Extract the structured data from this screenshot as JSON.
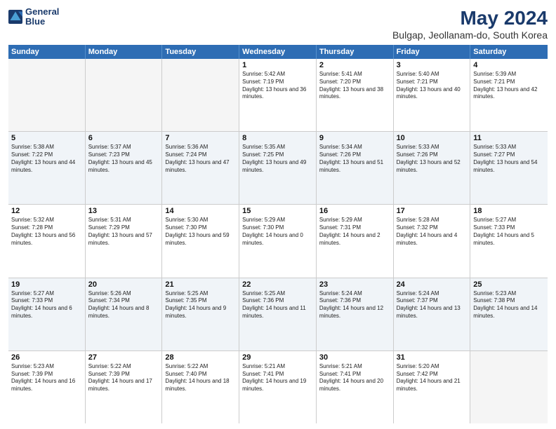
{
  "header": {
    "logo_line1": "General",
    "logo_line2": "Blue",
    "title": "May 2024",
    "subtitle": "Bulgap, Jeollanam-do, South Korea"
  },
  "days_of_week": [
    "Sunday",
    "Monday",
    "Tuesday",
    "Wednesday",
    "Thursday",
    "Friday",
    "Saturday"
  ],
  "weeks": [
    [
      {
        "day": "",
        "empty": true
      },
      {
        "day": "",
        "empty": true
      },
      {
        "day": "",
        "empty": true
      },
      {
        "day": "1",
        "sunrise": "5:42 AM",
        "sunset": "7:19 PM",
        "daylight": "13 hours and 36 minutes."
      },
      {
        "day": "2",
        "sunrise": "5:41 AM",
        "sunset": "7:20 PM",
        "daylight": "13 hours and 38 minutes."
      },
      {
        "day": "3",
        "sunrise": "5:40 AM",
        "sunset": "7:21 PM",
        "daylight": "13 hours and 40 minutes."
      },
      {
        "day": "4",
        "sunrise": "5:39 AM",
        "sunset": "7:21 PM",
        "daylight": "13 hours and 42 minutes."
      }
    ],
    [
      {
        "day": "5",
        "sunrise": "5:38 AM",
        "sunset": "7:22 PM",
        "daylight": "13 hours and 44 minutes."
      },
      {
        "day": "6",
        "sunrise": "5:37 AM",
        "sunset": "7:23 PM",
        "daylight": "13 hours and 45 minutes."
      },
      {
        "day": "7",
        "sunrise": "5:36 AM",
        "sunset": "7:24 PM",
        "daylight": "13 hours and 47 minutes."
      },
      {
        "day": "8",
        "sunrise": "5:35 AM",
        "sunset": "7:25 PM",
        "daylight": "13 hours and 49 minutes."
      },
      {
        "day": "9",
        "sunrise": "5:34 AM",
        "sunset": "7:26 PM",
        "daylight": "13 hours and 51 minutes."
      },
      {
        "day": "10",
        "sunrise": "5:33 AM",
        "sunset": "7:26 PM",
        "daylight": "13 hours and 52 minutes."
      },
      {
        "day": "11",
        "sunrise": "5:33 AM",
        "sunset": "7:27 PM",
        "daylight": "13 hours and 54 minutes."
      }
    ],
    [
      {
        "day": "12",
        "sunrise": "5:32 AM",
        "sunset": "7:28 PM",
        "daylight": "13 hours and 56 minutes."
      },
      {
        "day": "13",
        "sunrise": "5:31 AM",
        "sunset": "7:29 PM",
        "daylight": "13 hours and 57 minutes."
      },
      {
        "day": "14",
        "sunrise": "5:30 AM",
        "sunset": "7:30 PM",
        "daylight": "13 hours and 59 minutes."
      },
      {
        "day": "15",
        "sunrise": "5:29 AM",
        "sunset": "7:30 PM",
        "daylight": "14 hours and 0 minutes."
      },
      {
        "day": "16",
        "sunrise": "5:29 AM",
        "sunset": "7:31 PM",
        "daylight": "14 hours and 2 minutes."
      },
      {
        "day": "17",
        "sunrise": "5:28 AM",
        "sunset": "7:32 PM",
        "daylight": "14 hours and 4 minutes."
      },
      {
        "day": "18",
        "sunrise": "5:27 AM",
        "sunset": "7:33 PM",
        "daylight": "14 hours and 5 minutes."
      }
    ],
    [
      {
        "day": "19",
        "sunrise": "5:27 AM",
        "sunset": "7:33 PM",
        "daylight": "14 hours and 6 minutes."
      },
      {
        "day": "20",
        "sunrise": "5:26 AM",
        "sunset": "7:34 PM",
        "daylight": "14 hours and 8 minutes."
      },
      {
        "day": "21",
        "sunrise": "5:25 AM",
        "sunset": "7:35 PM",
        "daylight": "14 hours and 9 minutes."
      },
      {
        "day": "22",
        "sunrise": "5:25 AM",
        "sunset": "7:36 PM",
        "daylight": "14 hours and 11 minutes."
      },
      {
        "day": "23",
        "sunrise": "5:24 AM",
        "sunset": "7:36 PM",
        "daylight": "14 hours and 12 minutes."
      },
      {
        "day": "24",
        "sunrise": "5:24 AM",
        "sunset": "7:37 PM",
        "daylight": "14 hours and 13 minutes."
      },
      {
        "day": "25",
        "sunrise": "5:23 AM",
        "sunset": "7:38 PM",
        "daylight": "14 hours and 14 minutes."
      }
    ],
    [
      {
        "day": "26",
        "sunrise": "5:23 AM",
        "sunset": "7:39 PM",
        "daylight": "14 hours and 16 minutes."
      },
      {
        "day": "27",
        "sunrise": "5:22 AM",
        "sunset": "7:39 PM",
        "daylight": "14 hours and 17 minutes."
      },
      {
        "day": "28",
        "sunrise": "5:22 AM",
        "sunset": "7:40 PM",
        "daylight": "14 hours and 18 minutes."
      },
      {
        "day": "29",
        "sunrise": "5:21 AM",
        "sunset": "7:41 PM",
        "daylight": "14 hours and 19 minutes."
      },
      {
        "day": "30",
        "sunrise": "5:21 AM",
        "sunset": "7:41 PM",
        "daylight": "14 hours and 20 minutes."
      },
      {
        "day": "31",
        "sunrise": "5:20 AM",
        "sunset": "7:42 PM",
        "daylight": "14 hours and 21 minutes."
      },
      {
        "day": "",
        "empty": true
      }
    ]
  ]
}
